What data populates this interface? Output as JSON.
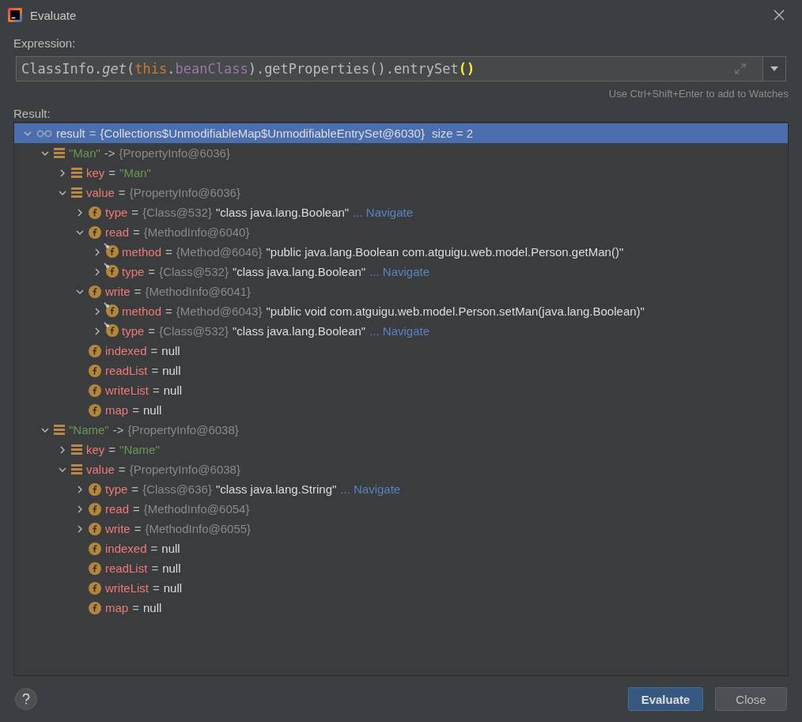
{
  "window": {
    "title": "Evaluate"
  },
  "expression": {
    "label": "Expression:",
    "tokens": [
      {
        "text": "ClassInfo.",
        "kind": "plain"
      },
      {
        "text": "get",
        "kind": "method"
      },
      {
        "text": "(",
        "kind": "plain"
      },
      {
        "text": "this",
        "kind": "keyword"
      },
      {
        "text": ".",
        "kind": "plain"
      },
      {
        "text": "beanClass",
        "kind": "field"
      },
      {
        "text": ").getProperties().entrySet",
        "kind": "plain"
      },
      {
        "text": "()",
        "kind": "match"
      }
    ],
    "hint": "Use Ctrl+Shift+Enter to add to Watches"
  },
  "result_label": "Result:",
  "tree": [
    {
      "kind": "result",
      "name": "result",
      "op": "=",
      "ref": "{Collections$UnmodifiableMap$UnmodifiableEntrySet@6030}",
      "extra": "size = 2",
      "selected": true,
      "expanded": true,
      "children": [
        {
          "kind": "entry",
          "name": "\"Man\"",
          "op": "->",
          "ref": "{PropertyInfo@6036}",
          "selected": false,
          "expanded": true,
          "children": [
            {
              "kind": "entry-field",
              "name": "key",
              "op": "=",
              "value": "\"Man\"",
              "is_string": true,
              "selected": false,
              "expanded": false
            },
            {
              "kind": "entry-field",
              "name": "value",
              "op": "=",
              "ref": "{PropertyInfo@6036}",
              "selected": false,
              "expanded": true,
              "children": [
                {
                  "kind": "field",
                  "name": "type",
                  "op": "=",
                  "ref": "{Class@532}",
                  "value": "\"class java.lang.Boolean\"",
                  "is_string": false,
                  "link": "... Navigate",
                  "selected": false,
                  "expanded": false
                },
                {
                  "kind": "field",
                  "name": "read",
                  "op": "=",
                  "ref": "{MethodInfo@6040}",
                  "selected": false,
                  "expanded": true,
                  "children": [
                    {
                      "kind": "final-field",
                      "name": "method",
                      "op": "=",
                      "ref": "{Method@6046}",
                      "value": "\"public java.lang.Boolean com.atguigu.web.model.Person.getMan()\"",
                      "is_string": false,
                      "selected": false,
                      "expanded": false
                    },
                    {
                      "kind": "final-field",
                      "name": "type",
                      "op": "=",
                      "ref": "{Class@532}",
                      "value": "\"class java.lang.Boolean\"",
                      "is_string": false,
                      "link": "... Navigate",
                      "selected": false,
                      "expanded": false
                    }
                  ]
                },
                {
                  "kind": "field",
                  "name": "write",
                  "op": "=",
                  "ref": "{MethodInfo@6041}",
                  "selected": false,
                  "expanded": true,
                  "children": [
                    {
                      "kind": "final-field",
                      "name": "method",
                      "op": "=",
                      "ref": "{Method@6043}",
                      "value": "\"public void com.atguigu.web.model.Person.setMan(java.lang.Boolean)\"",
                      "is_string": false,
                      "selected": false,
                      "expanded": false
                    },
                    {
                      "kind": "final-field",
                      "name": "type",
                      "op": "=",
                      "ref": "{Class@532}",
                      "value": "\"class java.lang.Boolean\"",
                      "is_string": false,
                      "link": "... Navigate",
                      "selected": false,
                      "expanded": false
                    }
                  ]
                },
                {
                  "kind": "field",
                  "name": "indexed",
                  "op": "=",
                  "value": "null",
                  "is_string": false,
                  "selected": false
                },
                {
                  "kind": "field",
                  "name": "readList",
                  "op": "=",
                  "value": "null",
                  "is_string": false,
                  "selected": false
                },
                {
                  "kind": "field",
                  "name": "writeList",
                  "op": "=",
                  "value": "null",
                  "is_string": false,
                  "selected": false
                },
                {
                  "kind": "field",
                  "name": "map",
                  "op": "=",
                  "value": "null",
                  "is_string": false,
                  "selected": false
                }
              ]
            }
          ]
        },
        {
          "kind": "entry",
          "name": "\"Name\"",
          "op": "->",
          "ref": "{PropertyInfo@6038}",
          "selected": false,
          "expanded": true,
          "children": [
            {
              "kind": "entry-field",
              "name": "key",
              "op": "=",
              "value": "\"Name\"",
              "is_string": true,
              "selected": false,
              "expanded": false
            },
            {
              "kind": "entry-field",
              "name": "value",
              "op": "=",
              "ref": "{PropertyInfo@6038}",
              "selected": false,
              "expanded": true,
              "children": [
                {
                  "kind": "field",
                  "name": "type",
                  "op": "=",
                  "ref": "{Class@636}",
                  "value": "\"class java.lang.String\"",
                  "is_string": false,
                  "link": "... Navigate",
                  "selected": false,
                  "expanded": false
                },
                {
                  "kind": "field",
                  "name": "read",
                  "op": "=",
                  "ref": "{MethodInfo@6054}",
                  "selected": false,
                  "expanded": false
                },
                {
                  "kind": "field",
                  "name": "write",
                  "op": "=",
                  "ref": "{MethodInfo@6055}",
                  "selected": false,
                  "expanded": false
                },
                {
                  "kind": "field",
                  "name": "indexed",
                  "op": "=",
                  "value": "null",
                  "is_string": false,
                  "selected": false
                },
                {
                  "kind": "field",
                  "name": "readList",
                  "op": "=",
                  "value": "null",
                  "is_string": false,
                  "selected": false
                },
                {
                  "kind": "field",
                  "name": "writeList",
                  "op": "=",
                  "value": "null",
                  "is_string": false,
                  "selected": false
                },
                {
                  "kind": "field",
                  "name": "map",
                  "op": "=",
                  "value": "null",
                  "is_string": false,
                  "selected": false
                }
              ]
            }
          ]
        }
      ]
    }
  ],
  "buttons": [
    {
      "label": "Evaluate",
      "kind": "primary"
    },
    {
      "label": "Close",
      "kind": "secondary"
    }
  ]
}
